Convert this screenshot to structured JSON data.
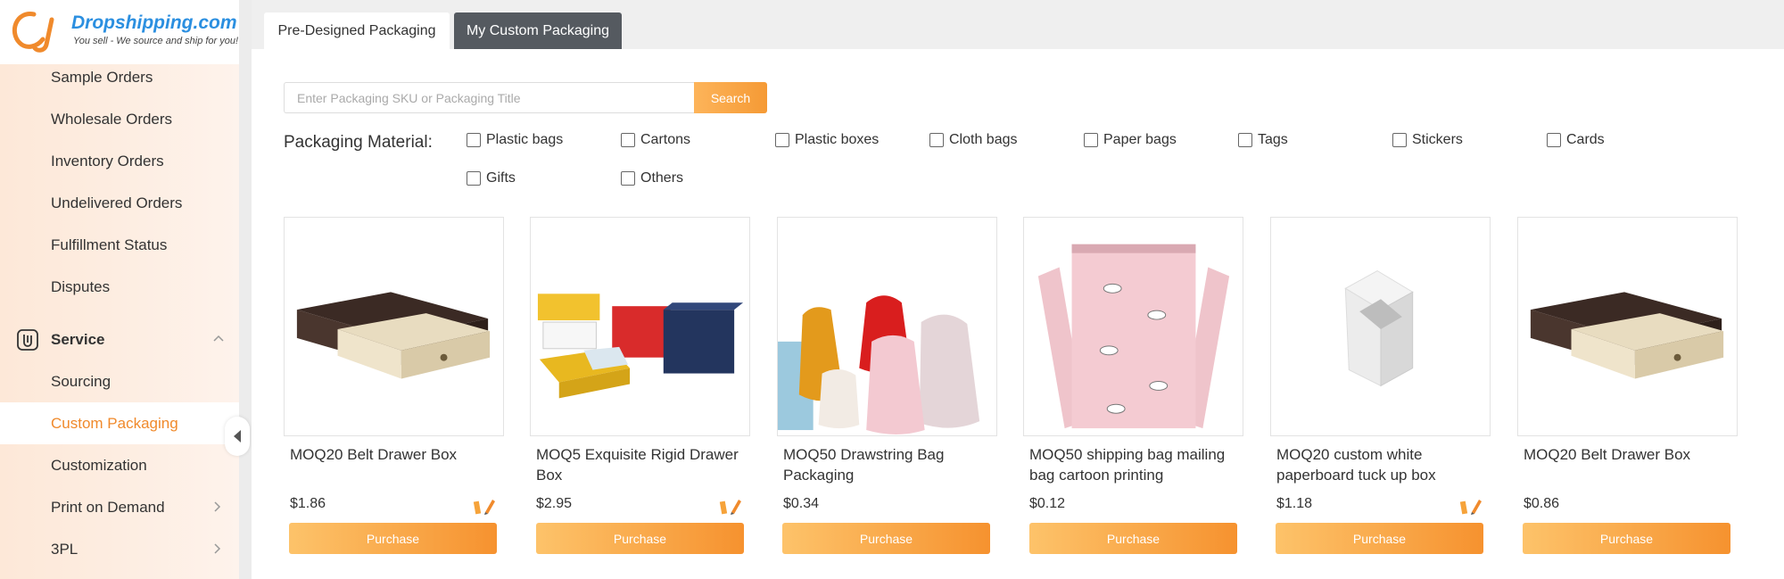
{
  "logo": {
    "title": "Dropshipping.com",
    "subtitle": "You sell - We source and ship for you!"
  },
  "sidebar": {
    "items_top": [
      {
        "label": "Sample Orders"
      },
      {
        "label": "Wholesale Orders"
      },
      {
        "label": "Inventory Orders"
      },
      {
        "label": "Undelivered Orders"
      },
      {
        "label": "Fulfillment Status"
      },
      {
        "label": "Disputes"
      }
    ],
    "section": {
      "label": "Service"
    },
    "items_service": [
      {
        "label": "Sourcing"
      },
      {
        "label": "Custom Packaging"
      },
      {
        "label": "Customization"
      },
      {
        "label": "Print on Demand"
      },
      {
        "label": "3PL"
      }
    ]
  },
  "tabs": [
    {
      "label": "Pre-Designed Packaging"
    },
    {
      "label": "My Custom Packaging"
    }
  ],
  "search": {
    "placeholder": "Enter Packaging SKU or Packaging Title",
    "button": "Search"
  },
  "filters": {
    "label": "Packaging Material:",
    "options": [
      "Plastic bags",
      "Cartons",
      "Plastic boxes",
      "Cloth bags",
      "Paper bags",
      "Tags",
      "Stickers",
      "Cards",
      "Gifts",
      "Others"
    ]
  },
  "products": [
    {
      "name": "MOQ20 Belt Drawer Box",
      "price": "$1.86",
      "button": "Purchase"
    },
    {
      "name": "MOQ5 Exquisite Rigid Drawer Box",
      "price": "$2.95",
      "button": "Purchase"
    },
    {
      "name": "MOQ50 Drawstring Bag Packaging",
      "price": "$0.34",
      "button": "Purchase"
    },
    {
      "name": "MOQ50 shipping bag mailing bag cartoon printing",
      "price": "$0.12",
      "button": "Purchase"
    },
    {
      "name": "MOQ20 custom white paperboard tuck up box",
      "price": "$1.18",
      "button": "Purchase"
    },
    {
      "name": "MOQ20 Belt Drawer Box",
      "price": "$0.86",
      "button": "Purchase"
    }
  ],
  "colors": {
    "accent": "#f08a2c",
    "brand": "#2b8fe0",
    "active_tab": "#555a60"
  }
}
